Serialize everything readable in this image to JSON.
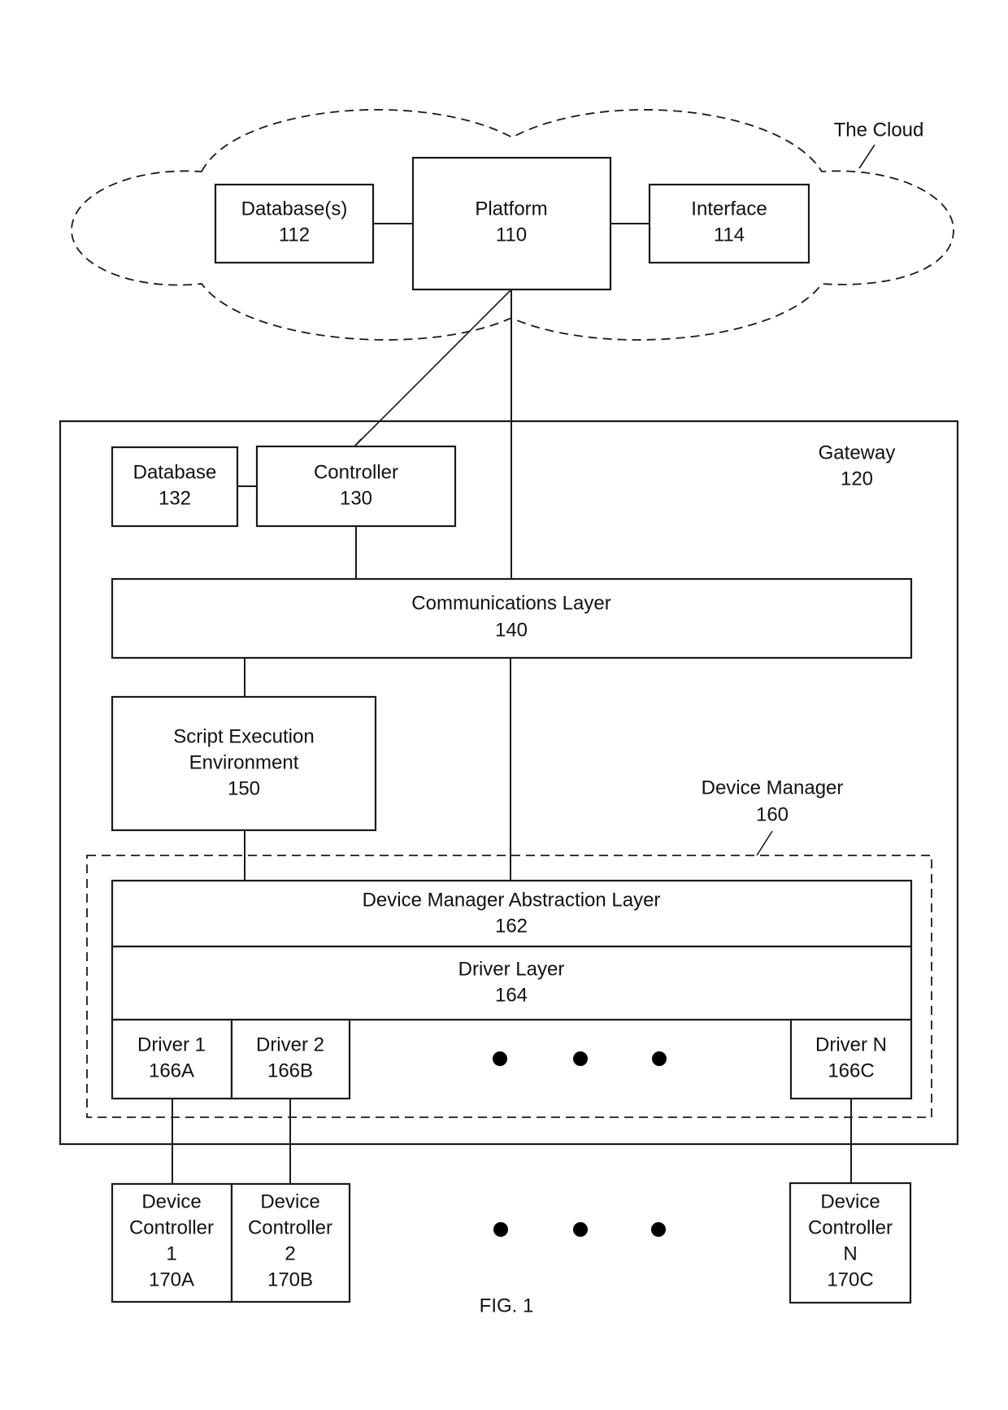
{
  "figure": {
    "caption": "FIG. 1"
  },
  "cloud": {
    "label": "The Cloud",
    "database": {
      "name": "Database(s)",
      "ref": "112"
    },
    "platform": {
      "name": "Platform",
      "ref": "110"
    },
    "interface": {
      "name": "Interface",
      "ref": "114"
    }
  },
  "gateway": {
    "name": "Gateway",
    "ref": "120",
    "database": {
      "name": "Database",
      "ref": "132"
    },
    "controller": {
      "name": "Controller",
      "ref": "130"
    },
    "communications_layer": {
      "name": "Communications Layer",
      "ref": "140"
    },
    "script_env": {
      "line1": "Script Execution",
      "line2": "Environment",
      "ref": "150"
    },
    "device_manager": {
      "name": "Device Manager",
      "ref": "160",
      "abstraction_layer": {
        "name": "Device Manager Abstraction Layer",
        "ref": "162"
      },
      "driver_layer": {
        "name": "Driver Layer",
        "ref": "164"
      },
      "drivers": [
        {
          "name": "Driver 1",
          "ref": "166A"
        },
        {
          "name": "Driver 2",
          "ref": "166B"
        },
        {
          "name": "Driver N",
          "ref": "166C"
        }
      ]
    }
  },
  "device_controllers": [
    {
      "line1": "Device",
      "line2": "Controller",
      "index": "1",
      "ref": "170A"
    },
    {
      "line1": "Device",
      "line2": "Controller",
      "index": "2",
      "ref": "170B"
    },
    {
      "line1": "Device",
      "line2": "Controller",
      "index": "N",
      "ref": "170C"
    }
  ]
}
